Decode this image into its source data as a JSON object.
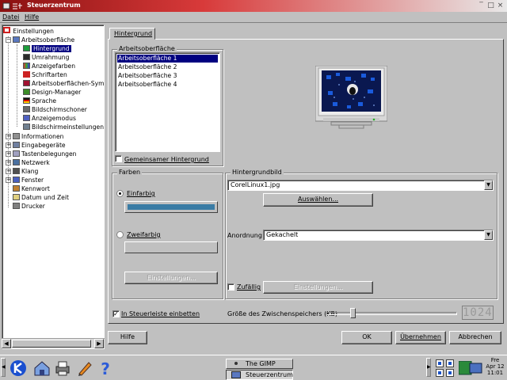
{
  "window": {
    "title": "Steuerzentrum"
  },
  "menubar": {
    "items": [
      "Datei",
      "Hilfe"
    ]
  },
  "tree": {
    "root": "Einstellungen",
    "items": [
      "Arbeitsoberfläche",
      "Hintergrund",
      "Umrahmung",
      "Anzeigefarben",
      "Schriftarten",
      "Arbeitsoberflächen-Sym",
      "Design-Manager",
      "Sprache",
      "Bildschirmschoner",
      "Anzeigemodus",
      "Bildschirmeinstellungen",
      "Informationen",
      "Eingabegeräte",
      "Tastenbelegungen",
      "Netzwerk",
      "Klang",
      "Fenster",
      "Kennwort",
      "Datum und Zeit",
      "Drucker"
    ],
    "selected": "Hintergrund"
  },
  "tab": {
    "label": "Hintergrund"
  },
  "desktop_group": {
    "title": "Arbeitsoberfläche",
    "list": [
      "Arbeitsoberfläche 1",
      "Arbeitsoberfläche 2",
      "Arbeitsoberfläche 3",
      "Arbeitsoberfläche 4"
    ],
    "selected_index": 0,
    "common_label": "Gemeinsamer Hintergrund",
    "common_checked": false
  },
  "colors_group": {
    "title": "Farben",
    "radio_solid": "Einfarbig",
    "radio_two": "Zweifarbig",
    "selected": "Einfarbig",
    "color1": "#3a7ca5",
    "color2": "#c0c0c0",
    "settings_button": "Einstellungen..."
  },
  "image_group": {
    "title": "Hintergrundbild",
    "file": "CorelLinux1.jpg",
    "browse_button": "Auswählen...",
    "arrangement_label": "Anordnung:",
    "arrangement_value": "Gekachelt",
    "random_label": "Zufällig",
    "random_checked": false,
    "settings_button": "Einstellungen..."
  },
  "dock": {
    "label": "In Steuerleiste einbetten",
    "checked": true
  },
  "cache": {
    "label": "Größe des Zwischenspeichers (KB)",
    "value": "1024",
    "fraction": 0.18
  },
  "buttons": {
    "help": "Hilfe",
    "ok": "OK",
    "apply": "Übernehmen",
    "cancel": "Abbrechen"
  },
  "taskbar": {
    "tasks": [
      "The GIMP",
      "Steuerzentrum"
    ],
    "active": "Steuerzentrum",
    "clock": {
      "day": "Fre",
      "date": "Apr 12",
      "time": "11:01"
    },
    "app_icons": [
      "kde-logo-icon",
      "home-folder-icon",
      "printer-icon",
      "pencil-icon",
      "help-icon"
    ]
  }
}
